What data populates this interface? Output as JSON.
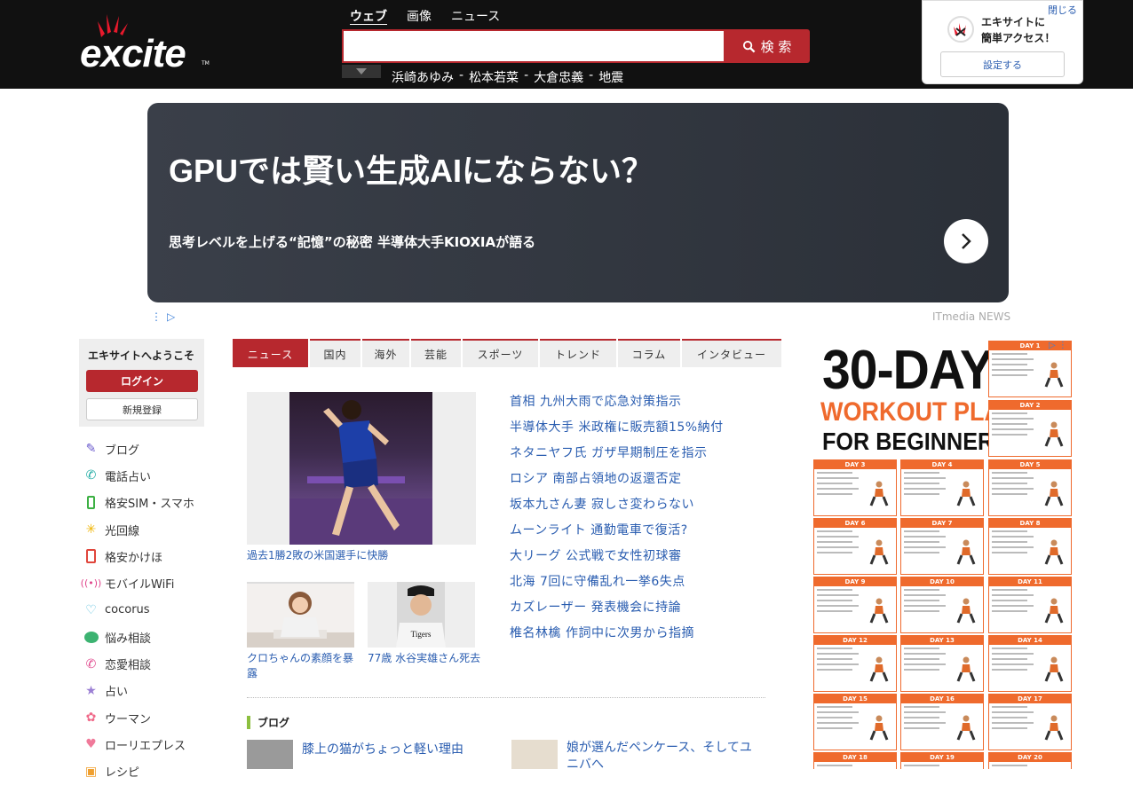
{
  "header": {
    "logo_text": "excite",
    "logo_tm": "TM",
    "search_tabs": [
      {
        "label": "ウェブ",
        "active": true
      },
      {
        "label": "画像",
        "active": false
      },
      {
        "label": "ニュース",
        "active": false
      }
    ],
    "search_placeholder": "",
    "search_button": "検 索",
    "trending": [
      "浜崎あゆみ",
      "松本若菜",
      "大倉忠義",
      "地震"
    ],
    "trending_sep": "-"
  },
  "quick_access": {
    "close": "閉じる",
    "line1": "エキサイトに",
    "line2": "簡単アクセス！",
    "settings": "設定する"
  },
  "ad_banner": {
    "title": "GPUでは賢い生成AIにならない？",
    "subtitle": "思考レベルを上げる“記憶”の秘密 半導体大手KIOXIAが語る",
    "source": "ITmedia NEWS"
  },
  "welcome": {
    "title": "エキサイトへようこそ",
    "login": "ログイン",
    "register": "新規登録"
  },
  "side_nav": [
    {
      "label": "ブログ",
      "icon": "pencil-icon",
      "color": "#6a5acd"
    },
    {
      "label": "電話占い",
      "icon": "phone-icon",
      "color": "#18a8a0"
    },
    {
      "label": "格安SIM・スマホ",
      "icon": "smartphone-icon",
      "color": "#3cb043"
    },
    {
      "label": "光回線",
      "icon": "light-icon",
      "color": "#f0b400"
    },
    {
      "label": "格安かけほ",
      "icon": "phone-call-icon",
      "color": "#e0463c"
    },
    {
      "label": "モバイルWiFi",
      "icon": "wifi-icon",
      "color": "#e0468c"
    },
    {
      "label": "cocorus",
      "icon": "heart-outline-icon",
      "color": "#5bc0de"
    },
    {
      "label": "悩み相談",
      "icon": "chat-icon",
      "color": "#3cb371"
    },
    {
      "label": "恋愛相談",
      "icon": "love-phone-icon",
      "color": "#e0468c"
    },
    {
      "label": "占い",
      "icon": "star-icon",
      "color": "#9b7fd4"
    },
    {
      "label": "ウーマン",
      "icon": "woman-icon",
      "color": "#f06a8a"
    },
    {
      "label": "ローリエプレス",
      "icon": "heart-icon",
      "color": "#f07a9a"
    },
    {
      "label": "レシピ",
      "icon": "recipe-icon",
      "color": "#f0a030"
    }
  ],
  "category_tabs": [
    {
      "label": "ニュース",
      "active": true
    },
    {
      "label": "国内",
      "active": false
    },
    {
      "label": "海外",
      "active": false
    },
    {
      "label": "芸能",
      "active": false
    },
    {
      "label": "スポーツ",
      "active": false
    },
    {
      "label": "トレンド",
      "active": false
    },
    {
      "label": "コラム",
      "active": false
    },
    {
      "label": "インタビュー",
      "active": false
    }
  ],
  "featured": {
    "main_caption": "過去1勝2敗の米国選手に快勝",
    "sub1_caption": "クロちゃんの素顔を暴露",
    "sub2_caption": "77歳 水谷実雄さん死去",
    "sub2_jersey": "Tigers"
  },
  "headlines": [
    "首相 九州大雨で応急対策指示",
    "半導体大手 米政権に販売額15%納付",
    "ネタニヤフ氏 ガザ早期制圧を指示",
    "ロシア 南部占領地の返還否定",
    "坂本九さん妻 寂しさ変わらない",
    "ムーンライト 通勤電車で復活?",
    "大リーグ 公式戦で女性初球審",
    "北海 7回に守備乱れ一挙6失点",
    "カズレーザー 発表機会に持論",
    "椎名林檎 作詞中に次男から指摘"
  ],
  "blog": {
    "heading": "ブログ",
    "item1": "膝上の猫がちょっと軽い理由",
    "item2": "娘が選んだペンケース、そしてユニバへ"
  },
  "right_ad": {
    "line1": "30-DAY",
    "line2": "WORKOUT PLAN",
    "line3": "FOR BEGINNERS",
    "days": [
      "DAY 1",
      "DAY 2",
      "DAY 3",
      "DAY 4",
      "DAY 5",
      "DAY 6",
      "DAY 7",
      "DAY 8",
      "DAY 9",
      "DAY 10",
      "DAY 11",
      "DAY 12",
      "DAY 13",
      "DAY 14",
      "DAY 15",
      "DAY 16",
      "DAY 17",
      "DAY 18",
      "DAY 19",
      "DAY 20"
    ],
    "accent_color": "#ef6a2d"
  },
  "colors": {
    "brand_red": "#b7282e",
    "link_blue": "#2a5db0"
  }
}
